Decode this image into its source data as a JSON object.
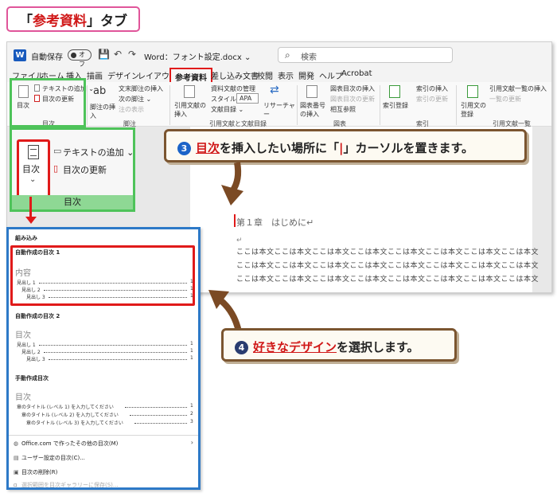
{
  "title_tag": {
    "open": "「",
    "highlight": "参考資料",
    "close": "」",
    "suffix": "タブ"
  },
  "word": {
    "logo": "W",
    "autosave_label": "自動保存",
    "autosave_state": "オフ",
    "quick_access": [
      "💾",
      "↶",
      "↷"
    ],
    "doc_title": "Word：フォント設定.docx ⌄",
    "search_placeholder": "検索",
    "tabs": [
      "ファイル",
      "ホーム",
      "挿入",
      "描画",
      "デザイン",
      "レイアウト",
      "参考資料",
      "差し込み文書",
      "校閲",
      "表示",
      "開発",
      "ヘルプ",
      "Acrobat"
    ],
    "active_tab": "参考資料",
    "ribbon": {
      "toc_button": "目次",
      "add_text": "テキストの追加 ⌄",
      "update_table": "目次の更新",
      "toc_group": "目次",
      "footnote_button": "脚注の挿入",
      "endnote": "文末脚注の挿入",
      "next_footnote": "次の脚注 ⌄",
      "show_notes": "注の表示",
      "footnote_group": "脚注",
      "insert_citation": "引用文献の挿入",
      "manage_sources": "資料文献の管理",
      "style_label": "スタイル:",
      "style_value": "APA",
      "bibliography": "文献目録 ⌄",
      "researcher": "リサーチャー",
      "citation_group": "引用文献と文献目録",
      "insert_caption": "図表番号の挿入",
      "insert_table_of_figures": "図表目次の挿入",
      "update_table_figures": "図表目次の更新",
      "cross_reference": "相互参照",
      "caption_group": "図表",
      "mark_entry": "索引登録",
      "insert_index": "索引の挿入",
      "update_index": "索引の更新",
      "index_group": "索引",
      "mark_citation": "引用文の登録",
      "insert_authorities": "引用文献一覧の挿入",
      "update_authorities": "一覧の更新",
      "authorities_group": "引用文献一覧"
    },
    "document": {
      "heading": "第１章　はじめに↵",
      "para_mark": "↵",
      "body_lines": [
        "ここは本文ここは本文ここは本文ここは本文ここは本文ここは本文ここは本文ここは本文",
        "ここは本文ここは本文ここは本文ここは本文ここは本文ここは本文ここは本文ここは本文",
        "ここは本文ここは本文ここは本文ここは本文ここは本文ここは本文ここは本文ここは本文"
      ]
    }
  },
  "zoom": {
    "toc_label": "目次",
    "chevron": "⌄",
    "add_text": "テキストの追加 ⌄",
    "update_table": "目次の更新",
    "group_label": "目次"
  },
  "gallery": {
    "built_in": "組み込み",
    "auto1_title": "自動作成の目次 1",
    "auto1_heading": "内容",
    "auto2_title": "自動作成の目次 2",
    "auto2_heading": "目次",
    "entries": [
      "見出し 1",
      "見出し 2",
      "見出し 3"
    ],
    "page_num": "1",
    "manual_title": "手動作成目次",
    "manual_heading": "目次",
    "manual_entries": [
      "章のタイトル (レベル 1) を入力してください",
      "章のタイトル (レベル 2) を入力してください",
      "章のタイトル (レベル 3) を入力してください"
    ],
    "manual_nums": [
      "1",
      "2",
      "3"
    ],
    "menu_items": [
      "Office.com で作ったその他の目次(M)",
      "ユーザー設定の目次(C)...",
      "目次の削除(R)",
      "選択範囲を目次ギャラリーに保存(S)..."
    ]
  },
  "callout3": {
    "number": "3",
    "highlight": "目次",
    "text1": "を挿入したい場所に「",
    "bar": "|",
    "text2": "」カーソルを置きます。"
  },
  "callout4": {
    "number": "4",
    "highlight": "好きなデザイン",
    "text": "を選択します。"
  },
  "colors": {
    "accent_red": "#e01a1a",
    "green": "#4ec35a",
    "blue": "#2d79c7",
    "brown": "#7b5530"
  }
}
